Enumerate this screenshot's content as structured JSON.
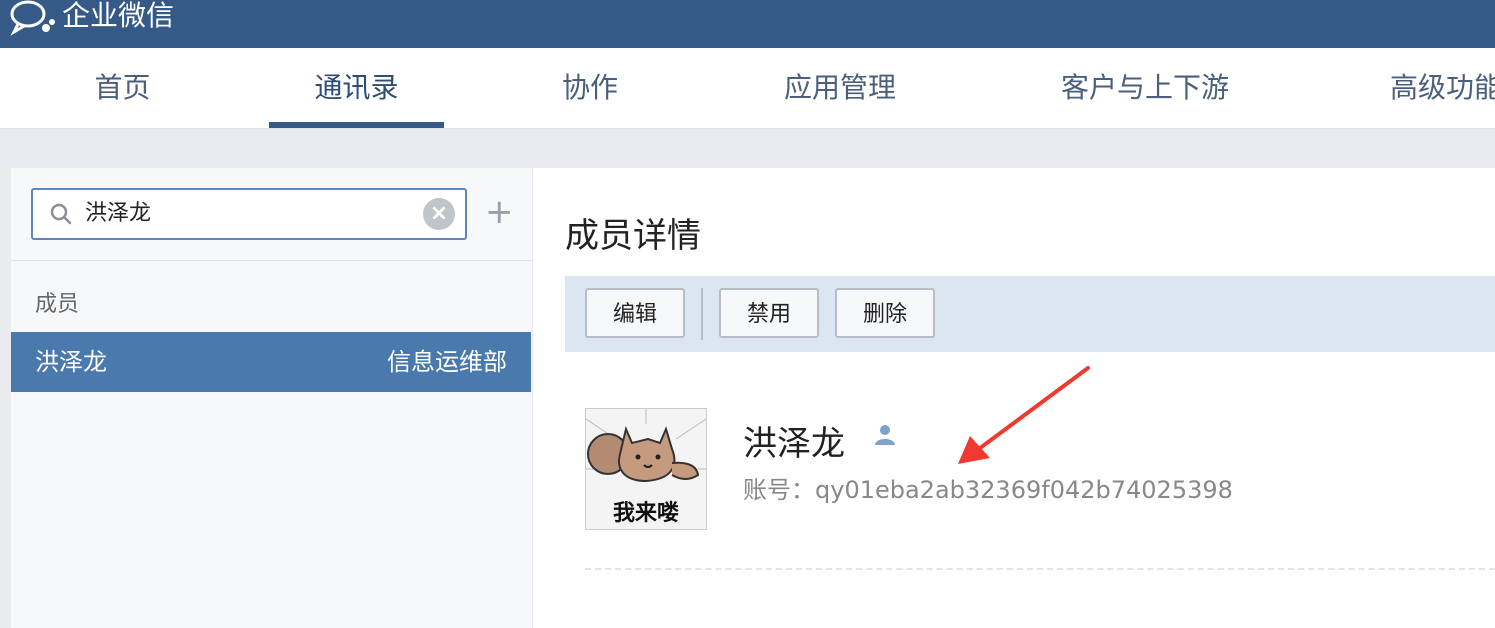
{
  "app": {
    "title": "企业微信"
  },
  "nav": {
    "tabs": [
      {
        "label": "首页"
      },
      {
        "label": "通讯录"
      },
      {
        "label": "协作"
      },
      {
        "label": "应用管理"
      },
      {
        "label": "客户与上下游"
      },
      {
        "label": "高级功能"
      }
    ],
    "active_tab": "通讯录"
  },
  "sidebar": {
    "search": {
      "value": "洪泽龙"
    },
    "section_label": "成员",
    "results": [
      {
        "name": "洪泽龙",
        "department": "信息运维部"
      }
    ]
  },
  "detail": {
    "title": "成员详情",
    "toolbar": {
      "edit": "编辑",
      "disable": "禁用",
      "delete": "删除"
    },
    "member": {
      "name": "洪泽龙",
      "avatar_caption": "我来喽",
      "account_label": "账号：",
      "account": "qy01eba2ab32369f042b74025398"
    }
  },
  "colors": {
    "topbar": "#355a87",
    "selected_row": "#4a79ae",
    "toolbar_bg": "#dce6f2",
    "annotation_arrow": "#f03a2f"
  }
}
